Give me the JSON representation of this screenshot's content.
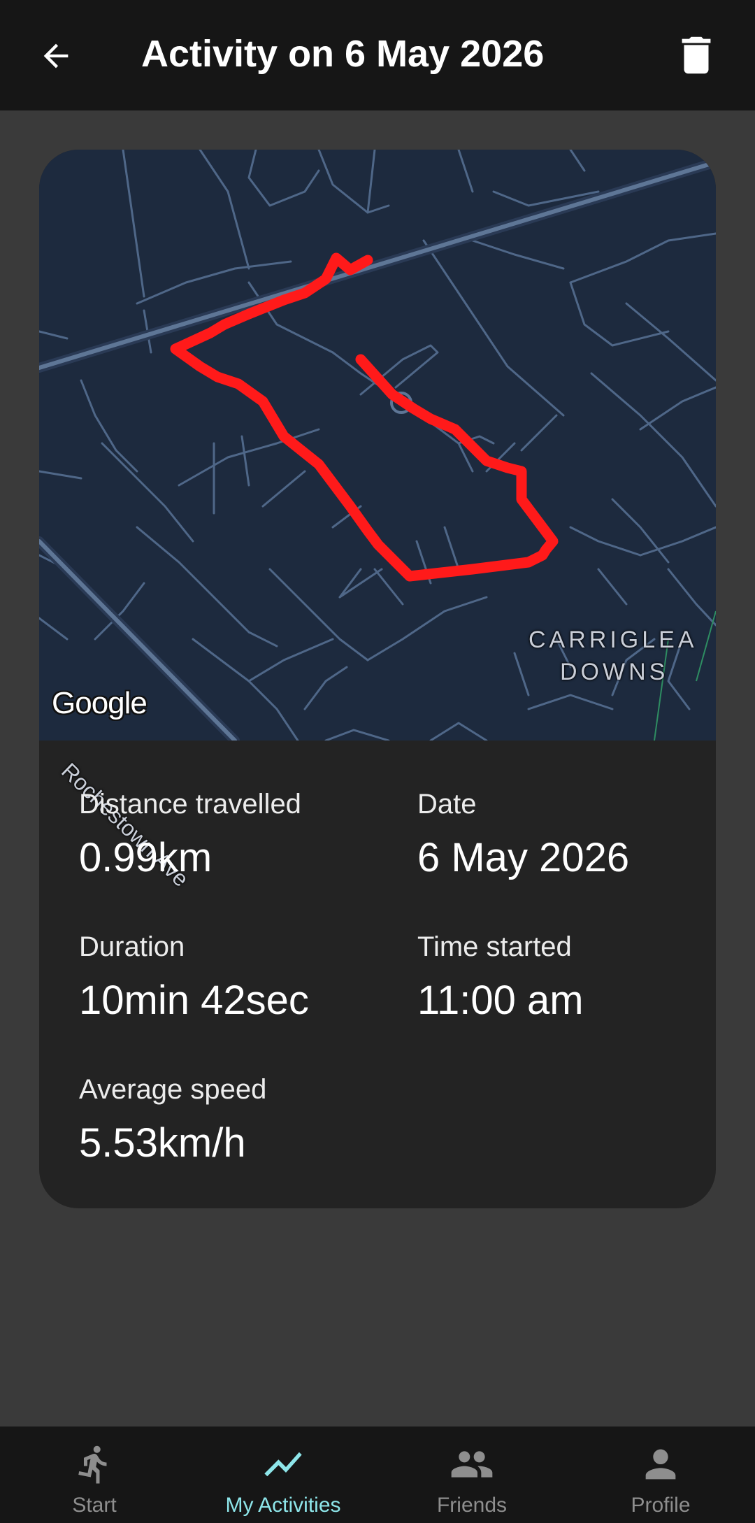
{
  "header": {
    "title": "Activity on 6 May 2026",
    "back_icon": "arrow-back-icon",
    "delete_icon": "trash-icon"
  },
  "map": {
    "area_label_line1": "CARRIGLEA",
    "area_label_line2": "DOWNS",
    "street_label": "Rochestown Ave",
    "attribution": "Google",
    "route_color": "#ff1a1a",
    "background_color": "#1d2a3e"
  },
  "stats": {
    "distance": {
      "label": "Distance travelled",
      "value": "0.99km"
    },
    "date": {
      "label": "Date",
      "value": "6 May 2026"
    },
    "duration": {
      "label": "Duration",
      "value": "10min 42sec"
    },
    "time_started": {
      "label": "Time started",
      "value": "11:00 am"
    },
    "average_speed": {
      "label": "Average speed",
      "value": "5.53km/h"
    }
  },
  "nav": {
    "items": [
      {
        "label": "Start",
        "icon": "run-icon",
        "active": false
      },
      {
        "label": "My Activities",
        "icon": "trend-icon",
        "active": true
      },
      {
        "label": "Friends",
        "icon": "people-icon",
        "active": false
      },
      {
        "label": "Profile",
        "icon": "person-icon",
        "active": false
      }
    ],
    "active_color": "#8ee6ea",
    "inactive_color": "#8e8e8e"
  }
}
